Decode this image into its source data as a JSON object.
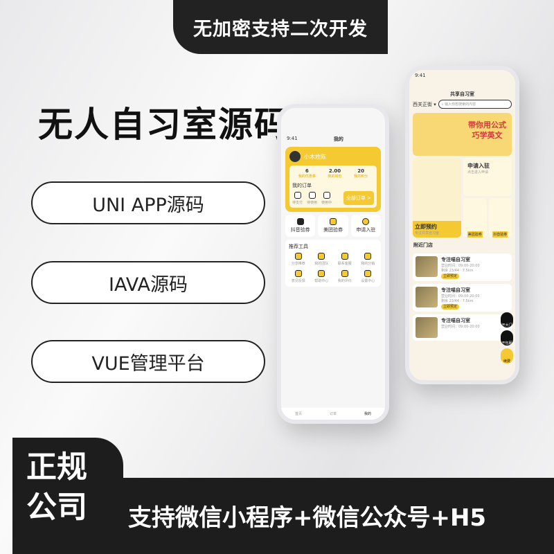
{
  "top_tab": "无加密支持二次开发",
  "title": "无人自习室源码",
  "pills": [
    "UNI APP源码",
    "IAVA源码",
    "VUE管理平台"
  ],
  "bottom": {
    "left": [
      "正规",
      "公司"
    ],
    "tagline": "支持微信小程序+微信公众号+H5"
  },
  "phone_left": {
    "time": "9:41",
    "title": "我的",
    "user": "小木姓陈",
    "stats": [
      {
        "value": "6",
        "label": "我的优惠券"
      },
      {
        "value": "2.00",
        "label": "我的钱包"
      },
      {
        "value": "20",
        "label": "我的积分"
      }
    ],
    "orders_label": "我的订单",
    "orders": [
      "待支付",
      "待使用",
      "使用中"
    ],
    "all_orders": "全部订单 >",
    "quick": [
      "抖音验券",
      "美团验券",
      "申请入驻"
    ],
    "tools_title": "推荐工具",
    "tools": [
      "分享推荐",
      "我的团队",
      "联系客服",
      "我的分销",
      "意见反馈",
      "帮助中心",
      "我的评价",
      "设置中心"
    ],
    "tabbar": [
      "首页",
      "订单",
      "我的"
    ]
  },
  "phone_right": {
    "time": "9:41",
    "title": "共享自习室",
    "city": "西关正街 ▾",
    "search_placeholder": "输入你想搜索的内容",
    "banner": [
      "带你用公式",
      "巧学英文"
    ],
    "apply": {
      "title": "申请入驻",
      "sub": "点击进入申请"
    },
    "book": {
      "title": "立即预约",
      "sub": "专注共享自习室"
    },
    "coupons": [
      "美团验券",
      "抖音验券"
    ],
    "nearby_title": "附近门店",
    "stores": [
      {
        "name": "专注喵自习室",
        "hours": "营业时间：09:00-20:00",
        "distance": "7.5km",
        "remain": "剩余 23/44",
        "action": "立即预定"
      },
      {
        "name": "专注喵自习室",
        "hours": "营业时间：09:00-20:00",
        "distance": "7.5km",
        "remain": "剩余 23/44",
        "action": "立即预定"
      },
      {
        "name": "专注喵自习室",
        "hours": "营业时间：09:00-20:00"
      }
    ],
    "float_buttons": [
      "开大门",
      "开包厢",
      "续费"
    ]
  },
  "colors": {
    "accent": "#f4c931",
    "dark": "#1d1d1d"
  }
}
